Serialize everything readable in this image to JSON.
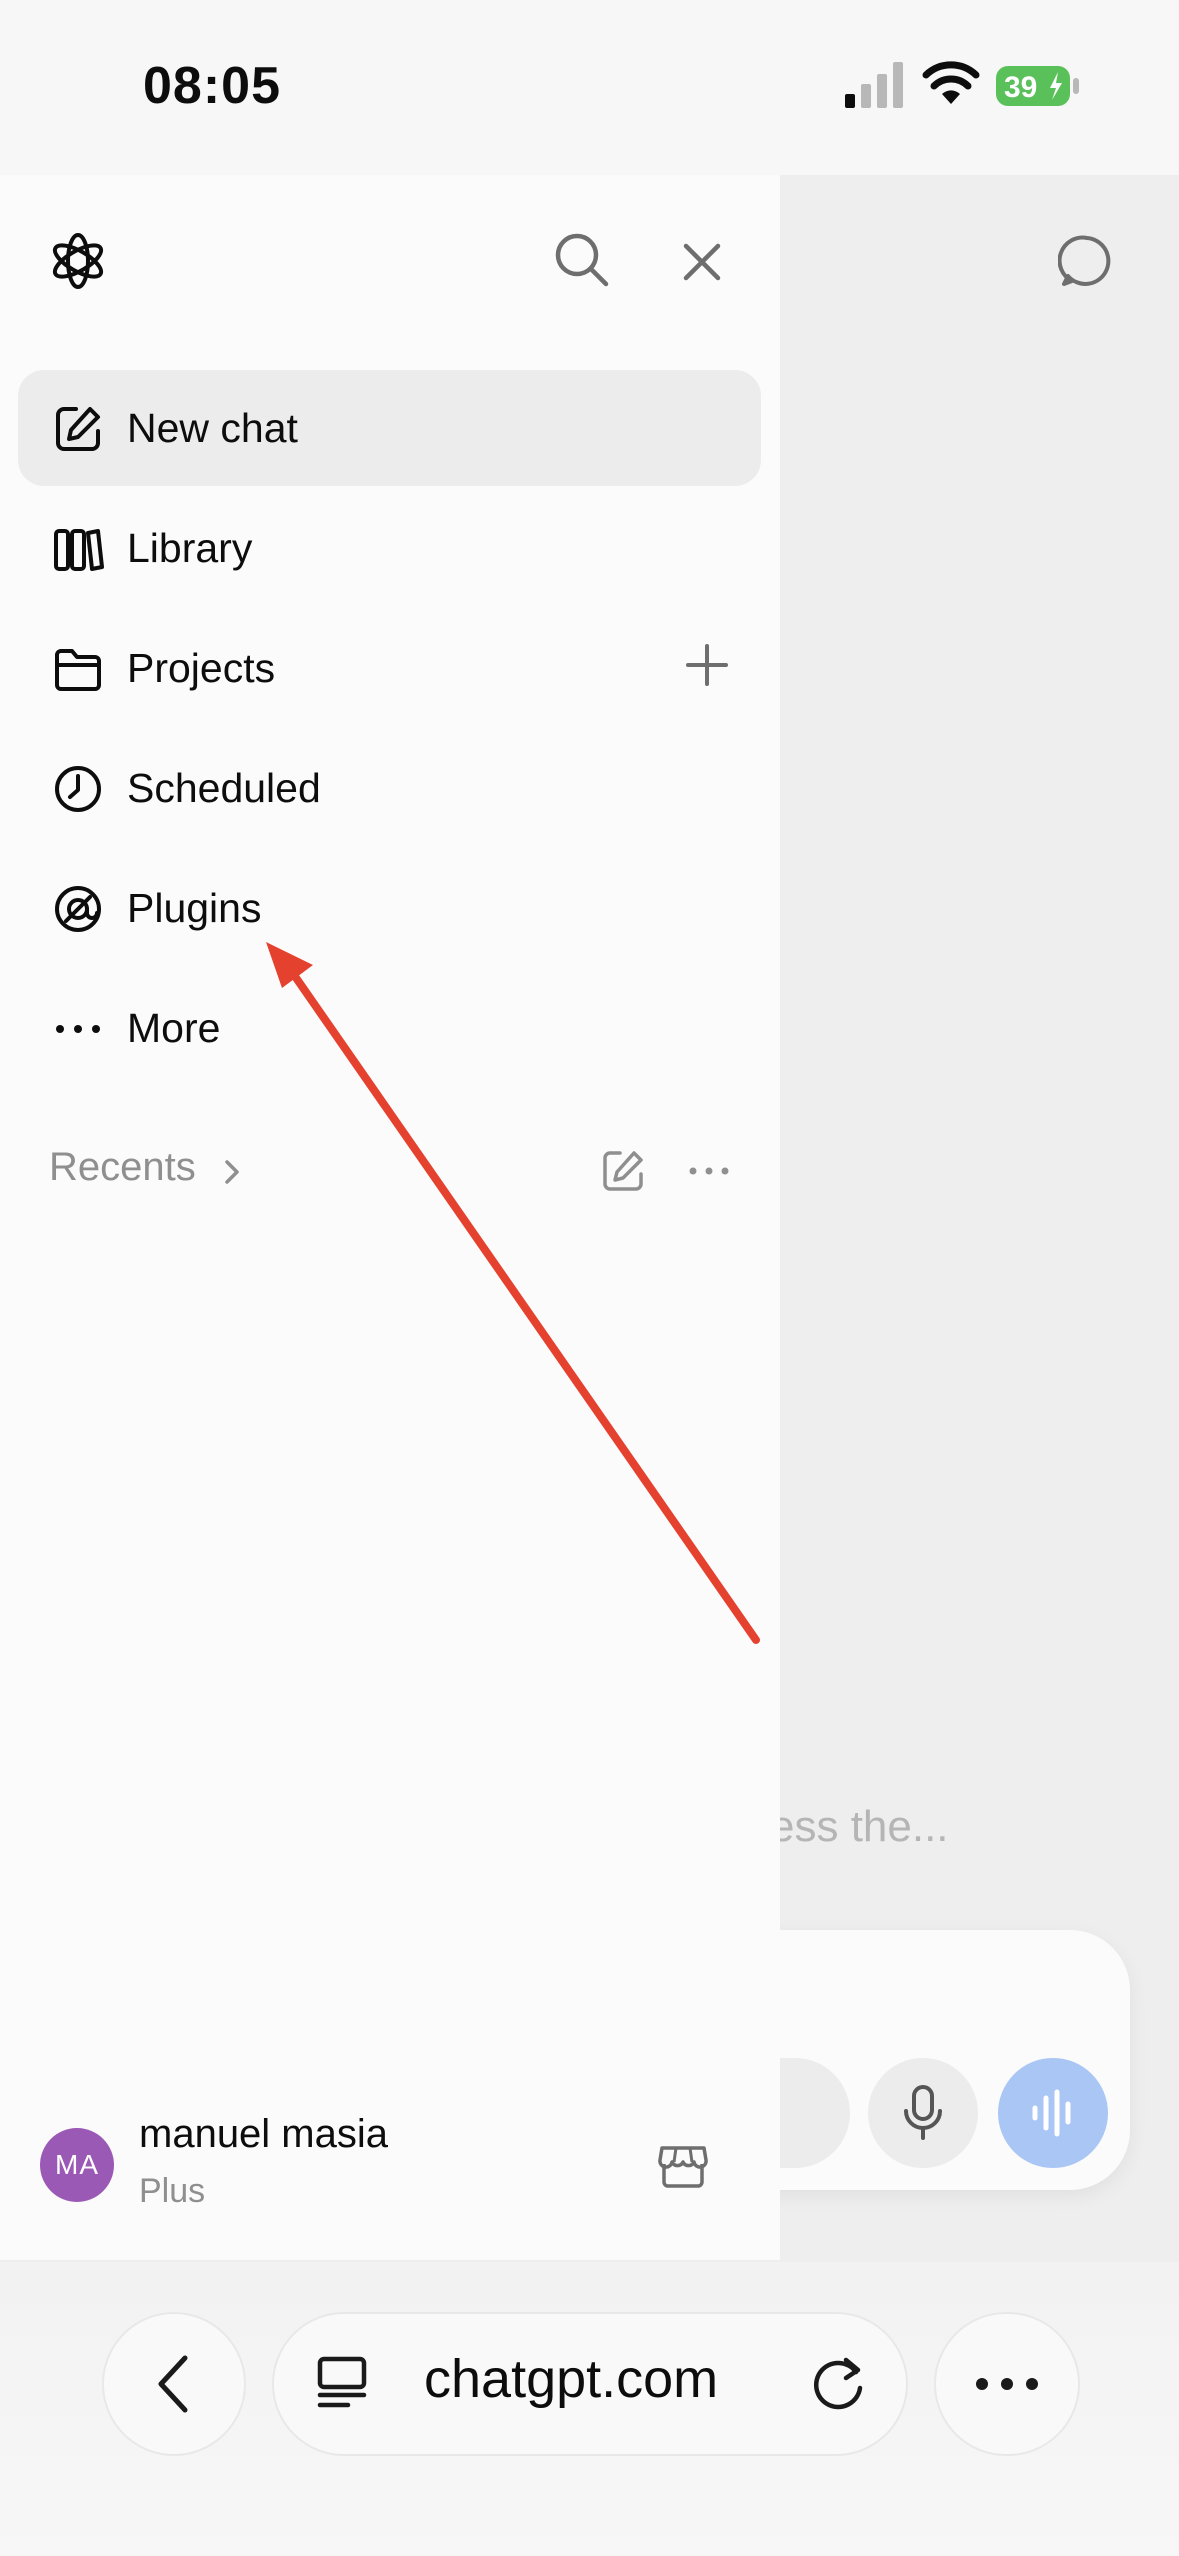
{
  "status_bar": {
    "time": "08:05",
    "battery": "39"
  },
  "drawer": {
    "nav": [
      {
        "label": "New chat",
        "icon": "compose-icon",
        "active": true
      },
      {
        "label": "Library",
        "icon": "library-icon"
      },
      {
        "label": "Projects",
        "icon": "folder-icon"
      },
      {
        "label": "Scheduled",
        "icon": "clock-icon"
      },
      {
        "label": "Plugins",
        "icon": "plugins-icon"
      },
      {
        "label": "More",
        "icon": "ellipsis-icon"
      }
    ],
    "recents_label": "Recents",
    "account": {
      "initials": "MA",
      "name": "manuel masia",
      "plan": "Plus"
    }
  },
  "background": {
    "suggestion_text": "ess the..."
  },
  "browser": {
    "url": "chatgpt.com"
  },
  "colors": {
    "annotation_arrow": "#e5412f",
    "avatar": "#9b59b6",
    "voice_button": "#a9c6f5"
  }
}
